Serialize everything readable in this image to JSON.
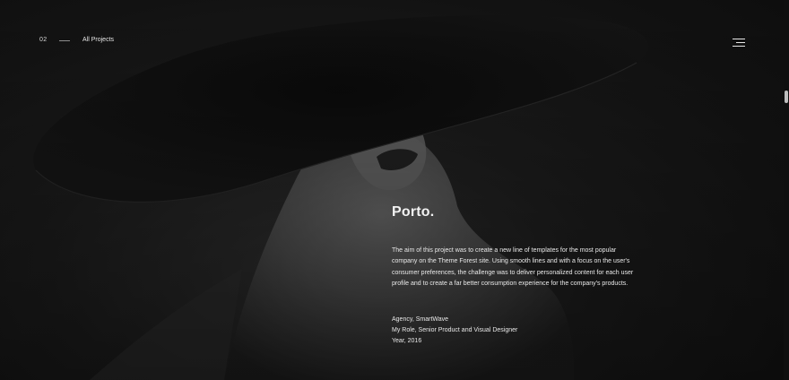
{
  "header": {
    "counter": "02",
    "all_projects_label": "All Projects",
    "menu_icon": "hamburger-menu-icon"
  },
  "project": {
    "title": "Porto.",
    "description": "The aim of this project was to create a new line of templates for the most popular company on the Theme Forest site. Using smooth lines and with a focus on the user's consumer preferences, the challenge was to deliver personalized content for each user profile and to create a far better consumption experience for the company's products.",
    "agency": "Agency, SmartWave",
    "role": "My Role, Senior Product and Visual Designer",
    "year": "Year, 2016"
  },
  "colors": {
    "background": "#141414",
    "text": "#f2f2f2",
    "muted_line": "#8c8c8c"
  }
}
